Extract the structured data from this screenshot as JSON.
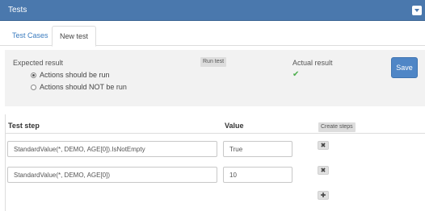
{
  "panel": {
    "title": "Tests"
  },
  "tabs": [
    {
      "label": "Test Cases",
      "active": false
    },
    {
      "label": "New test",
      "active": true
    }
  ],
  "config": {
    "expected_result_label": "Expected result",
    "options": [
      {
        "label": "Actions should be run",
        "selected": true
      },
      {
        "label": "Actions should NOT be run",
        "selected": false
      }
    ],
    "run_test_label": "Run test",
    "actual_result_label": "Actual result",
    "actual_result_icon": "check-icon",
    "save_label": "Save"
  },
  "steps_table": {
    "columns": [
      "Test step",
      "Value"
    ],
    "create_steps_label": "Create steps",
    "rows": [
      {
        "step": "StandardValue(*, DEMO, AGE[0]).IsNotEmpty",
        "value": "True"
      },
      {
        "step": "StandardValue(*, DEMO, AGE[0])",
        "value": "10"
      }
    ],
    "delete_icon": "✖",
    "add_icon": "✚"
  },
  "colors": {
    "header_bg": "#4a78ad",
    "link": "#3a7bbf",
    "primary_button": "#4f86c6",
    "success": "#4cae4c"
  }
}
